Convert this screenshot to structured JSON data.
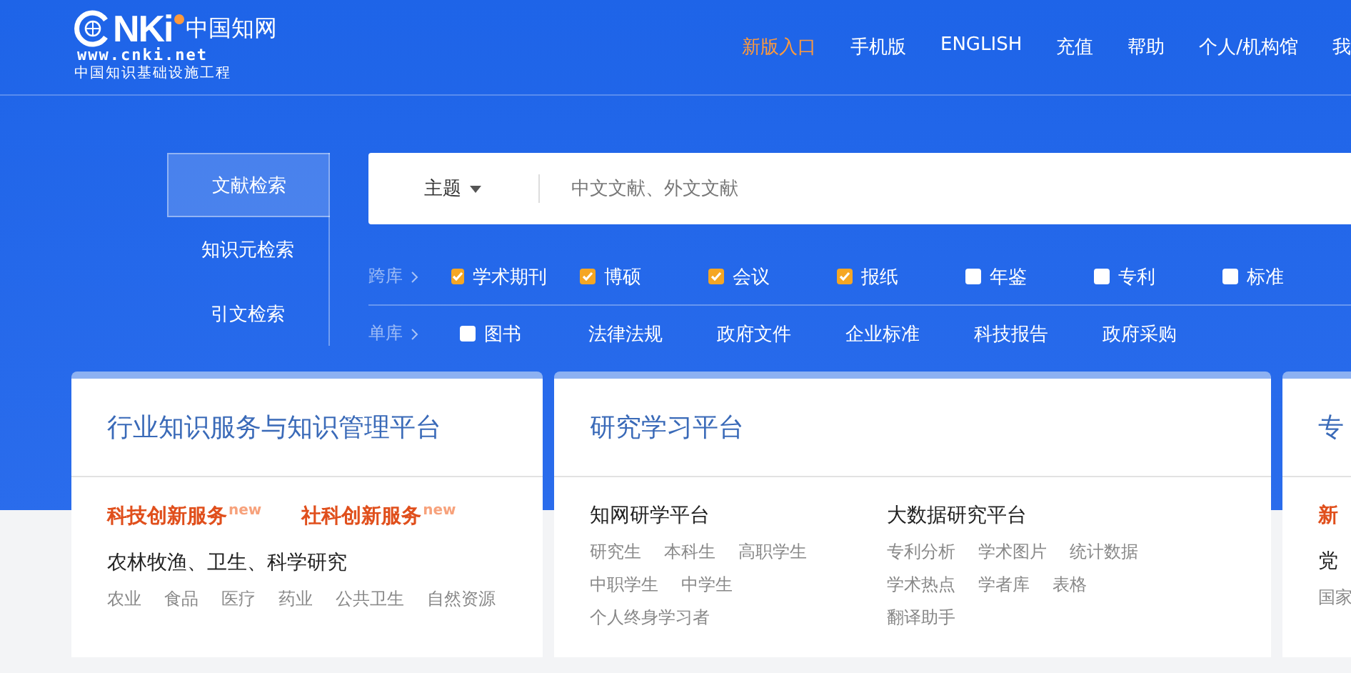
{
  "header": {
    "logo": {
      "mark": "NKi",
      "name": "中国知网",
      "url": "www.cnki.net",
      "slogan": "中国知识基础设施工程"
    },
    "nav": [
      {
        "label": "新版入口",
        "highlighted": true
      },
      {
        "label": "手机版",
        "highlighted": false
      },
      {
        "label": "ENGLISH",
        "highlighted": false
      },
      {
        "label": "充值",
        "highlighted": false
      },
      {
        "label": "帮助",
        "highlighted": false
      },
      {
        "label": "个人/机构馆",
        "highlighted": false
      },
      {
        "label": "我",
        "highlighted": false
      }
    ]
  },
  "search": {
    "tabs": [
      {
        "label": "文献检索",
        "selected": true
      },
      {
        "label": "知识元检索",
        "selected": false
      },
      {
        "label": "引文检索",
        "selected": false
      }
    ],
    "field_select": "主题",
    "placeholder": "中文文献、外文文献",
    "databases": [
      {
        "label": "跨库",
        "items": [
          {
            "kind": "checkbox",
            "label": "学术期刊",
            "checked": true
          },
          {
            "kind": "checkbox",
            "label": "博硕",
            "checked": true
          },
          {
            "kind": "checkbox",
            "label": "会议",
            "checked": true
          },
          {
            "kind": "checkbox",
            "label": "报纸",
            "checked": true
          },
          {
            "kind": "checkbox",
            "label": "年鉴",
            "checked": false
          },
          {
            "kind": "checkbox",
            "label": "专利",
            "checked": false
          },
          {
            "kind": "checkbox",
            "label": "标准",
            "checked": false
          }
        ]
      },
      {
        "label": "单库",
        "items": [
          {
            "kind": "checkbox",
            "label": "图书",
            "checked": false
          },
          {
            "kind": "link",
            "label": "法律法规"
          },
          {
            "kind": "link",
            "label": "政府文件"
          },
          {
            "kind": "link",
            "label": "企业标准"
          },
          {
            "kind": "link",
            "label": "科技报告"
          },
          {
            "kind": "link",
            "label": "政府采购"
          }
        ]
      }
    ]
  },
  "cards": [
    {
      "title": "行业知识服务与知识管理平台",
      "services": [
        {
          "label": "科技创新服务",
          "badge": "new"
        },
        {
          "label": "社科创新服务",
          "badge": "new"
        }
      ],
      "groups": [
        {
          "heading": "农林牧渔、卫生、科学研究",
          "links": [
            "农业",
            "食品",
            "医疗",
            "药业",
            "公共卫生",
            "自然资源"
          ]
        }
      ]
    },
    {
      "title": "研究学习平台",
      "groups": [
        {
          "heading": "知网研学平台",
          "links": [
            "研究生",
            "本科生",
            "高职学生",
            "中职学生",
            "中学生",
            "个人终身学习者"
          ]
        },
        {
          "heading": "大数据研究平台",
          "links": [
            "专利分析",
            "学术图片",
            "统计数据",
            "学术热点",
            "学者库",
            "表格",
            "翻译助手"
          ]
        }
      ]
    },
    {
      "title": "专",
      "services": [
        {
          "label": "新"
        }
      ],
      "groups": [
        {
          "heading": "党",
          "links": [
            "国家"
          ]
        }
      ]
    }
  ]
}
